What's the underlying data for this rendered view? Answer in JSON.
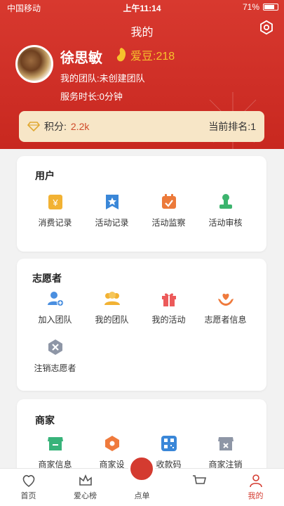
{
  "status_bar": {
    "carrier": "中国移动",
    "time": "上午11:14",
    "battery": "71%"
  },
  "header": {
    "title": "我的"
  },
  "profile": {
    "name": "徐思敏",
    "beans": "爱豆:218",
    "team": "我的团队:未创建团队",
    "service_time": "服务时长:0分钟"
  },
  "score": {
    "label": "积分:",
    "value": "2.2k",
    "rank": "当前排名:1"
  },
  "user_section": {
    "title": "用户",
    "items": [
      {
        "label": "消费记录",
        "icon": "receipt-icon"
      },
      {
        "label": "活动记录",
        "icon": "star-bookmark-icon"
      },
      {
        "label": "活动监察",
        "icon": "calendar-check-icon"
      },
      {
        "label": "活动审核",
        "icon": "stamp-icon"
      }
    ]
  },
  "volunteer_section": {
    "title": "志愿者",
    "items": [
      {
        "label": "加入团队",
        "icon": "add-user-icon"
      },
      {
        "label": "我的团队",
        "icon": "group-icon"
      },
      {
        "label": "我的活动",
        "icon": "gift-icon"
      },
      {
        "label": "志愿者信息",
        "icon": "heart-hands-icon"
      },
      {
        "label": "注销志愿者",
        "icon": "cancel-icon"
      }
    ]
  },
  "merchant_section": {
    "title": "商家",
    "items": [
      {
        "label": "商家信息",
        "icon": "shop-icon"
      },
      {
        "label": "商家设",
        "icon": "nut-icon"
      },
      {
        "label": "收款码",
        "icon": "qr-code-icon"
      },
      {
        "label": "商家注销",
        "icon": "shop-cancel-icon"
      }
    ]
  },
  "tabbar": [
    {
      "label": "首页",
      "icon": "heart-home-icon"
    },
    {
      "label": "爱心榜",
      "icon": "crown-icon"
    },
    {
      "label": "点单",
      "icon": "order-icon"
    },
    {
      "label": "",
      "icon": "cart-icon"
    },
    {
      "label": "我的",
      "icon": "user-icon"
    }
  ],
  "colors": {
    "header_red": "#d43b30",
    "bean_gold": "#f6c32c",
    "score_bg": "#f7e6c7"
  }
}
